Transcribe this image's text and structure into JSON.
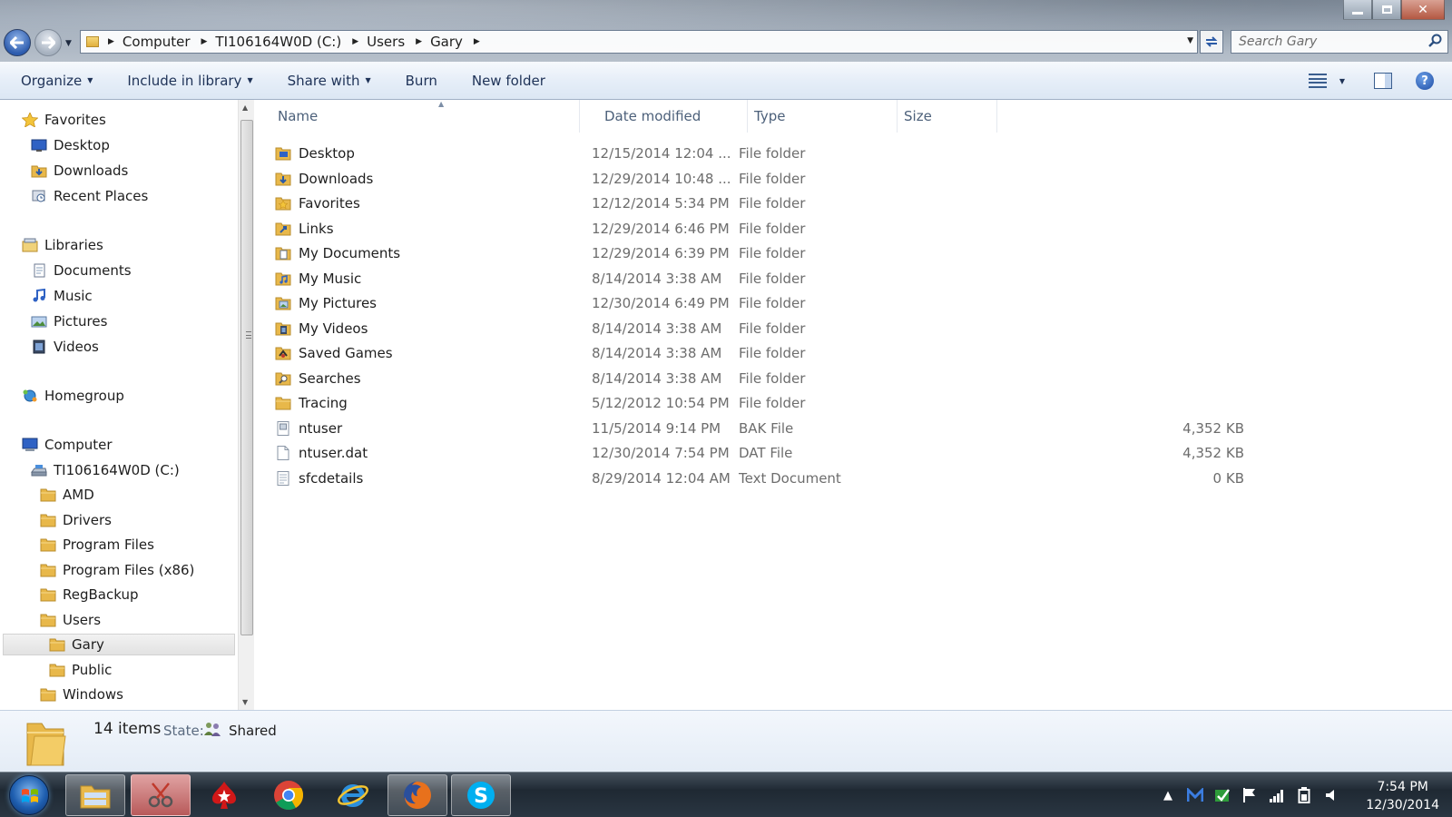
{
  "window": {
    "min_symbol": "",
    "max_symbol": "",
    "close_symbol": "✕"
  },
  "address": {
    "crumbs": [
      "Computer",
      "TI106164W0D (C:)",
      "Users",
      "Gary"
    ]
  },
  "search": {
    "placeholder": "Search Gary"
  },
  "toolbar": {
    "organize": "Organize",
    "include_in_library": "Include in library",
    "share_with": "Share with",
    "burn": "Burn",
    "new_folder": "New folder",
    "help": "?"
  },
  "nav_tree": {
    "favorites": "Favorites",
    "desktop": "Desktop",
    "downloads": "Downloads",
    "recent_places": "Recent Places",
    "libraries": "Libraries",
    "documents": "Documents",
    "music": "Music",
    "pictures": "Pictures",
    "videos": "Videos",
    "homegroup": "Homegroup",
    "computer": "Computer",
    "drive": "TI106164W0D (C:)",
    "amd": "AMD",
    "drivers": "Drivers",
    "program_files": "Program Files",
    "program_files_x86": "Program Files (x86)",
    "regbackup": "RegBackup",
    "users": "Users",
    "gary": "Gary",
    "public": "Public",
    "windows": "Windows"
  },
  "columns": {
    "name": "Name",
    "date_modified": "Date modified",
    "type": "Type",
    "size": "Size"
  },
  "files": [
    {
      "name": "Desktop",
      "date": "12/15/2014 12:04 ...",
      "type": "File folder",
      "size": "",
      "icon": "desktop-folder-icon"
    },
    {
      "name": "Downloads",
      "date": "12/29/2014 10:48 ...",
      "type": "File folder",
      "size": "",
      "icon": "downloads-folder-icon"
    },
    {
      "name": "Favorites",
      "date": "12/12/2014 5:34 PM",
      "type": "File folder",
      "size": "",
      "icon": "favorites-folder-icon"
    },
    {
      "name": "Links",
      "date": "12/29/2014 6:46 PM",
      "type": "File folder",
      "size": "",
      "icon": "links-folder-icon"
    },
    {
      "name": "My Documents",
      "date": "12/29/2014 6:39 PM",
      "type": "File folder",
      "size": "",
      "icon": "documents-folder-icon"
    },
    {
      "name": "My Music",
      "date": "8/14/2014 3:38 AM",
      "type": "File folder",
      "size": "",
      "icon": "music-folder-icon"
    },
    {
      "name": "My Pictures",
      "date": "12/30/2014 6:49 PM",
      "type": "File folder",
      "size": "",
      "icon": "pictures-folder-icon"
    },
    {
      "name": "My Videos",
      "date": "8/14/2014 3:38 AM",
      "type": "File folder",
      "size": "",
      "icon": "videos-folder-icon"
    },
    {
      "name": "Saved Games",
      "date": "8/14/2014 3:38 AM",
      "type": "File folder",
      "size": "",
      "icon": "saved-games-folder-icon"
    },
    {
      "name": "Searches",
      "date": "8/14/2014 3:38 AM",
      "type": "File folder",
      "size": "",
      "icon": "searches-folder-icon"
    },
    {
      "name": "Tracing",
      "date": "5/12/2012 10:54 PM",
      "type": "File folder",
      "size": "",
      "icon": "folder-icon"
    },
    {
      "name": "ntuser",
      "date": "11/5/2014 9:14 PM",
      "type": "BAK File",
      "size": "4,352 KB",
      "icon": "bak-file-icon"
    },
    {
      "name": "ntuser.dat",
      "date": "12/30/2014 7:54 PM",
      "type": "DAT File",
      "size": "4,352 KB",
      "icon": "blank-file-icon"
    },
    {
      "name": "sfcdetails",
      "date": "8/29/2014 12:04 AM",
      "type": "Text Document",
      "size": "0 KB",
      "icon": "text-file-icon"
    }
  ],
  "details": {
    "item_count": "14 items",
    "state_label": "State:",
    "state_value": "Shared"
  },
  "taskbar": {
    "time": "7:54 PM",
    "date": "12/30/2014"
  },
  "colors": {
    "folder_yellow": "#e8b84a",
    "command_text": "#1e3257",
    "secondary_text": "#6d6d6d",
    "taskbar_bg": "#1f2933"
  }
}
